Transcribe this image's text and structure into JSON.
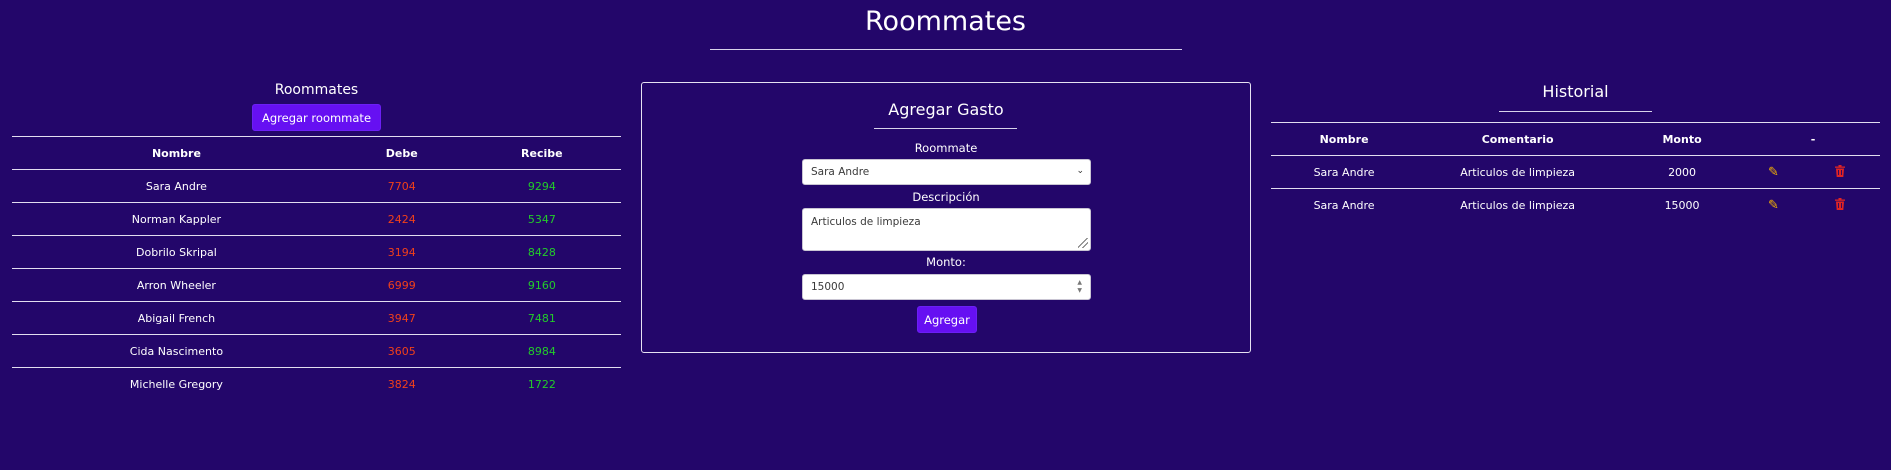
{
  "page": {
    "title": "Roommates"
  },
  "roommates": {
    "heading": "Roommates",
    "add_button": "Agregar roommate",
    "columns": [
      "Nombre",
      "Debe",
      "Recibe"
    ],
    "rows": [
      {
        "nombre": "Sara Andre",
        "debe": "7704",
        "recibe": "9294"
      },
      {
        "nombre": "Norman Kappler",
        "debe": "2424",
        "recibe": "5347"
      },
      {
        "nombre": "Dobrilo Skripal",
        "debe": "3194",
        "recibe": "8428"
      },
      {
        "nombre": "Arron Wheeler",
        "debe": "6999",
        "recibe": "9160"
      },
      {
        "nombre": "Abigail French",
        "debe": "3947",
        "recibe": "7481"
      },
      {
        "nombre": "Cida Nascimento",
        "debe": "3605",
        "recibe": "8984"
      },
      {
        "nombre": "Michelle Gregory",
        "debe": "3824",
        "recibe": "1722"
      }
    ]
  },
  "gasto": {
    "title": "Agregar Gasto",
    "roommate_label": "Roommate",
    "roommate_value": "Sara Andre",
    "descripcion_label": "Descripción",
    "descripcion_value": "Articulos de limpieza",
    "monto_label": "Monto:",
    "monto_value": "15000",
    "submit": "Agregar"
  },
  "historial": {
    "title": "Historial",
    "columns": [
      "Nombre",
      "Comentario",
      "Monto",
      "-"
    ],
    "rows": [
      {
        "nombre": "Sara Andre",
        "comentario": "Articulos de limpieza",
        "monto": "2000"
      },
      {
        "nombre": "Sara Andre",
        "comentario": "Articulos de limpieza",
        "monto": "15000"
      }
    ]
  },
  "colors": {
    "background": "#23066a",
    "button": "#6610f2",
    "debe": "#f0401a",
    "recibe": "#22cc2a",
    "edit": "#f7b500",
    "delete": "#e02424"
  },
  "icons": {
    "edit": "edit-icon",
    "delete": "trash-icon",
    "select": "chevron-down-icon"
  }
}
